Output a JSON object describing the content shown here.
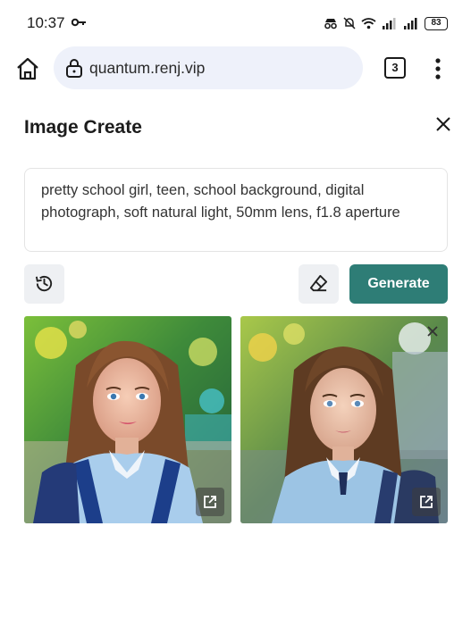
{
  "status_bar": {
    "time": "10:37",
    "battery": "83"
  },
  "browser": {
    "url": "quantum.renj.vip",
    "tab_count": "3"
  },
  "panel": {
    "title": "Image Create",
    "prompt": "pretty school girl, teen, school background, digital photograph, soft natural light, 50mm lens, f1.8 aperture",
    "generate_label": "Generate"
  },
  "colors": {
    "accent": "#2e7d76",
    "url_bar": "#eef1fa",
    "secondary_button": "#eef0f3"
  },
  "icons": [
    "key-icon",
    "wifi-icon",
    "signal-icon",
    "home-icon",
    "lock-icon",
    "more-vert-icon",
    "close-icon",
    "history-icon",
    "eraser-icon",
    "open-external-icon"
  ],
  "images": [
    {
      "id": "generated-image-1"
    },
    {
      "id": "generated-image-2"
    }
  ]
}
